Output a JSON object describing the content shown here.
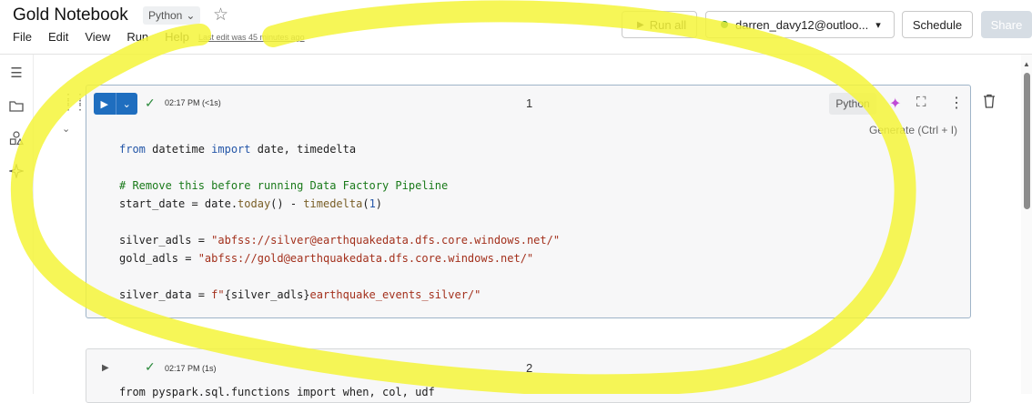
{
  "header": {
    "title": "Gold Notebook",
    "language": "Python",
    "menu": [
      "File",
      "Edit",
      "View",
      "Run",
      "Help"
    ],
    "last_edit": "Last edit was 45 minutes ago",
    "run_all": "Run all",
    "user": "darren_davy12@outloo...",
    "schedule": "Schedule",
    "share": "Share"
  },
  "rail": {
    "icons": [
      "table-of-contents-icon",
      "folder-icon",
      "shapes-icon",
      "assistant-sparkle-icon"
    ]
  },
  "cells": [
    {
      "number": "1",
      "exec_time": "02:17 PM (<1s)",
      "language": "Python",
      "generate": "Generate (Ctrl + I)",
      "lines": [
        "from datetime import date, timedelta",
        "",
        "# Remove this before running Data Factory Pipeline",
        "start_date = date.today() - timedelta(1)",
        "",
        "silver_adls = \"abfss://silver@earthquakedata.dfs.core.windows.net/\"",
        "gold_adls = \"abfss://gold@earthquakedata.dfs.core.windows.net/\"",
        "",
        "silver_data = f\"{silver_adls}earthquake_events_silver/\""
      ]
    },
    {
      "number": "2",
      "exec_time": "02:17 PM (1s)",
      "first_line": "from pyspark.sql.functions import when, col, udf"
    }
  ],
  "colors": {
    "run_button": "#1f6ebf",
    "highlight": "#f5f53a",
    "keyword": "#2456a8",
    "comment": "#1a7a1a",
    "string": "#a3301c"
  }
}
